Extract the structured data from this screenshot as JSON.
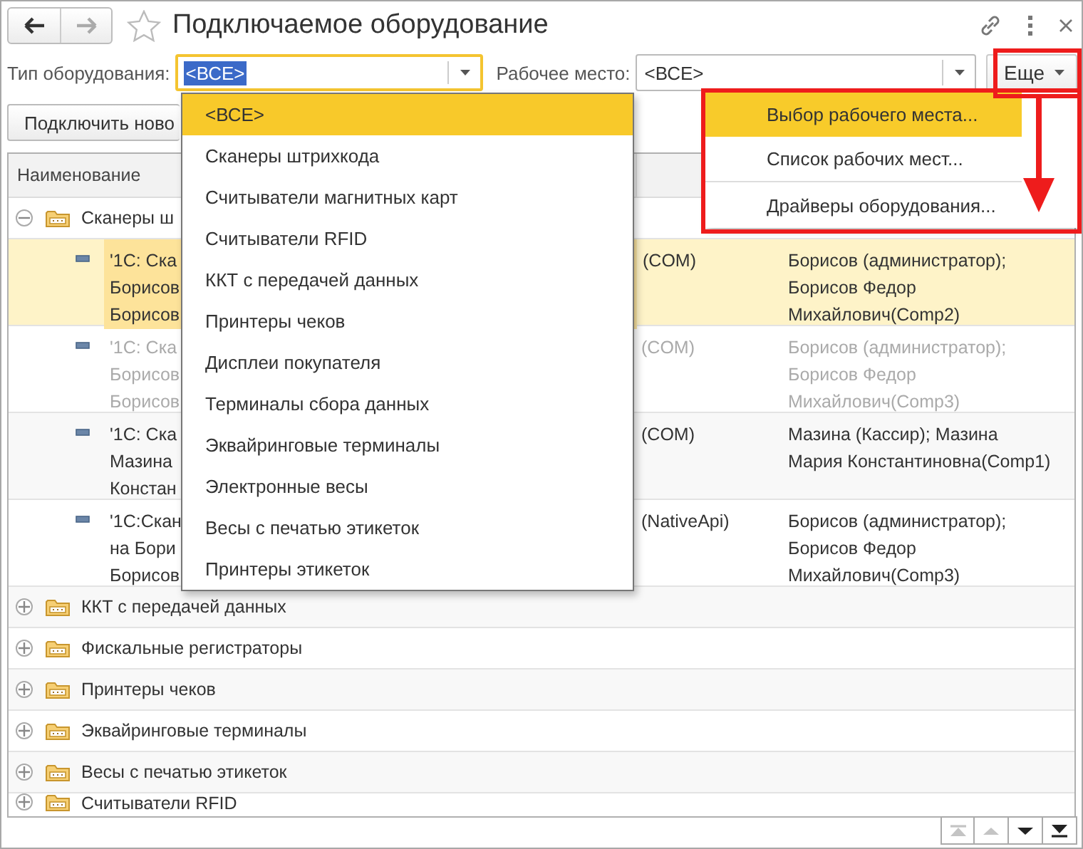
{
  "window": {
    "title": "Подключаемое оборудование"
  },
  "nav": [
    {
      "kind": "back",
      "disabled": false
    },
    {
      "kind": "forward",
      "disabled": true
    }
  ],
  "filters": [
    {
      "label": "Тип оборудования:",
      "value": "<ВСЕ>",
      "focused": true
    },
    {
      "label": "Рабочее место:",
      "value": "<ВСЕ>",
      "focused": false
    }
  ],
  "more_button": {
    "label": "Еще"
  },
  "toolbar": {
    "buttons": [
      "Подключить ново"
    ]
  },
  "table": {
    "columns": [
      "Наименование"
    ],
    "rows": [
      {
        "kind": "group",
        "name": "Сканеры ш",
        "expanded": true,
        "children": [
          {
            "kind": "device",
            "name": "'1С: Ска\nБорисов\nБорисов",
            "column_2": "(COM)",
            "column_3": "Борисов (администратор);\nБорисов Федор\nМихайлович(Comp2)",
            "selected": true,
            "disabled": false
          },
          {
            "kind": "device",
            "name": "'1С: Ска\nБорисов\nБорисов",
            "column_2": "(COM)",
            "column_3": "Борисов (администратор);\nБорисов Федор\nМихайлович(Comp3)",
            "selected": false,
            "disabled": true
          },
          {
            "kind": "device",
            "name": "'1С: Ска\nМазина\nКонстан",
            "column_2": "(COM)",
            "column_3": "Мазина (Кассир); Мазина\nМария Константиновна(Comp1)",
            "selected": false,
            "disabled": false
          },
          {
            "kind": "device",
            "name": "'1С:Скан\nна Бори\nБорисов",
            "column_2": "(NativeApi)",
            "column_3": "Борисов (администратор);\nБорисов Федор\nМихайлович(Comp3)",
            "selected": false,
            "disabled": false
          }
        ]
      },
      {
        "kind": "group",
        "name": "ККТ с передачей данных",
        "expanded": false
      },
      {
        "kind": "group",
        "name": "Фискальные регистраторы",
        "expanded": false
      },
      {
        "kind": "group",
        "name": "Принтеры чеков",
        "expanded": false
      },
      {
        "kind": "group",
        "name": "Эквайринговые терминалы",
        "expanded": false
      },
      {
        "kind": "group",
        "name": "Весы с печатью этикеток",
        "expanded": false
      },
      {
        "kind": "group",
        "name": "Считыватели RFID",
        "expanded": false
      }
    ]
  },
  "pager": [
    {
      "kind": "first",
      "disabled": true
    },
    {
      "kind": "up",
      "disabled": true
    },
    {
      "kind": "down",
      "disabled": false
    },
    {
      "kind": "last",
      "disabled": false
    }
  ],
  "dropdown": {
    "items": [
      {
        "label": "<ВСЕ>",
        "selected": true
      },
      {
        "label": "Сканеры штрихкода",
        "selected": false
      },
      {
        "label": "Считыватели магнитных карт",
        "selected": false
      },
      {
        "label": "Считыватели RFID",
        "selected": false
      },
      {
        "label": "ККТ с передачей данных",
        "selected": false
      },
      {
        "label": "Принтеры чеков",
        "selected": false
      },
      {
        "label": "Дисплеи покупателя",
        "selected": false
      },
      {
        "label": "Терминалы сбора данных",
        "selected": false
      },
      {
        "label": "Эквайринговые терминалы",
        "selected": false
      },
      {
        "label": "Электронные весы",
        "selected": false
      },
      {
        "label": "Весы с печатью этикеток",
        "selected": false
      },
      {
        "label": "Принтеры этикеток",
        "selected": false
      }
    ]
  },
  "more_menu": {
    "items": [
      {
        "label": "Выбор рабочего места...",
        "selected": true,
        "divider_above": false
      },
      {
        "label": "Список рабочих мест...",
        "selected": false,
        "divider_above": false
      },
      {
        "label": "Драйверы оборудования...",
        "selected": false,
        "divider_above": true
      }
    ]
  }
}
